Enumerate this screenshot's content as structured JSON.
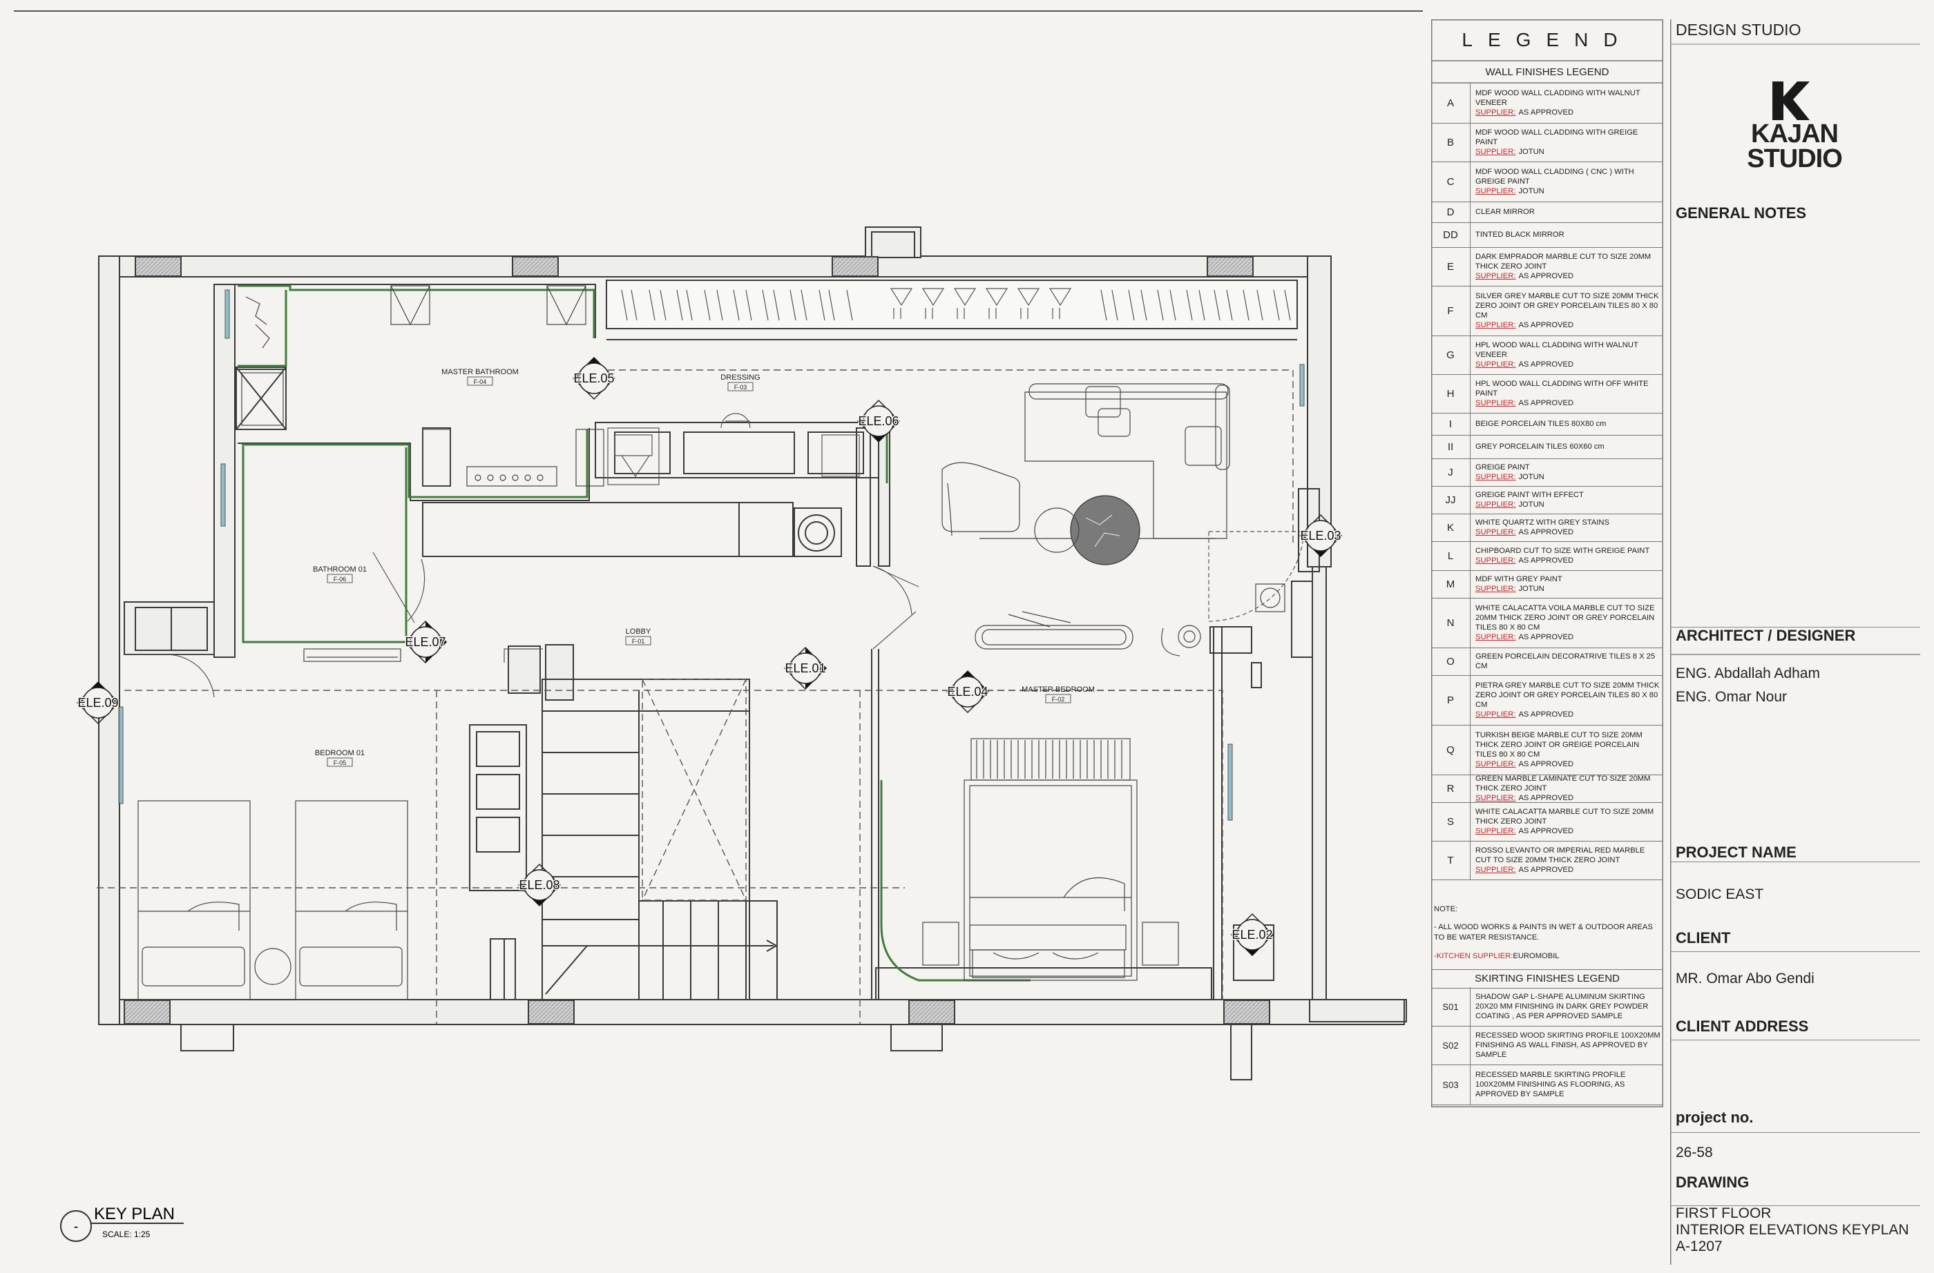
{
  "plan": {
    "rooms": [
      {
        "name": "MASTER BATHROOM",
        "code": "F-04"
      },
      {
        "name": "DRESSING",
        "code": "F-03"
      },
      {
        "name": "BATHROOM 01",
        "code": "F-06"
      },
      {
        "name": "LOBBY",
        "code": "F-01"
      },
      {
        "name": "BEDROOM 01",
        "code": "F-05"
      },
      {
        "name": "MASTER BEDROOM",
        "code": "F-02"
      }
    ],
    "elevation_tags": [
      "ELE.01",
      "ELE.02",
      "ELE.03",
      "ELE.04",
      "ELE.05",
      "ELE.06",
      "ELE.07",
      "ELE.08",
      "ELE.09"
    ],
    "key_plan": {
      "symbol": "-",
      "title": "KEY PLAN",
      "scale": "SCALE: 1:25"
    }
  },
  "legend": {
    "title": "LEGEND",
    "wall_title": "WALL FINISHES LEGEND",
    "supplier_label": "SUPPLIER:",
    "wall_items": [
      {
        "code": "A",
        "text": "MDF WOOD WALL CLADDING WITH WALNUT VENEER",
        "supplier": "AS APPROVED"
      },
      {
        "code": "B",
        "text": "MDF WOOD WALL CLADDING WITH  GREIGE PAINT",
        "supplier": "JOTUN"
      },
      {
        "code": "C",
        "text": "MDF WOOD WALL CLADDING ( CNC ) WITH GREIGE PAINT",
        "supplier": "JOTUN"
      },
      {
        "code": "D",
        "text": "CLEAR MIRROR",
        "supplier": ""
      },
      {
        "code": "DD",
        "text": "TINTED BLACK MIRROR",
        "supplier": ""
      },
      {
        "code": "E",
        "text": "DARK EMPRADOR MARBLE CUT TO SIZE 20MM THICK ZERO JOINT",
        "supplier": "AS APPROVED"
      },
      {
        "code": "F",
        "text": "SILVER GREY MARBLE CUT TO SIZE 20MM THICK ZERO JOINT OR GREY PORCELAIN TILES 80 X 80 CM",
        "supplier": "AS APPROVED"
      },
      {
        "code": "G",
        "text": "HPL WOOD WALL CLADDING WITH WALNUT VENEER",
        "supplier": "AS APPROVED"
      },
      {
        "code": "H",
        "text": "HPL WOOD WALL CLADDING WITH OFF WHITE PAINT",
        "supplier": "AS APPROVED"
      },
      {
        "code": "I",
        "text": "BEIGE PORCELAIN TILES  80X80 cm",
        "supplier": ""
      },
      {
        "code": "II",
        "text": "GREY PORCELAIN TILES  60X60 cm",
        "supplier": ""
      },
      {
        "code": "J",
        "text": "GREIGE PAINT",
        "supplier": "JOTUN"
      },
      {
        "code": "JJ",
        "text": "GREIGE PAINT WITH EFFECT",
        "supplier": "JOTUN"
      },
      {
        "code": "K",
        "text": "WHITE QUARTZ WITH GREY STAINS",
        "supplier": "AS APPROVED"
      },
      {
        "code": "L",
        "text": "CHIPBOARD  CUT TO SIZE WITH GREIGE PAINT",
        "supplier": "AS APPROVED"
      },
      {
        "code": "M",
        "text": "MDF WITH GREY PAINT",
        "supplier": "JOTUN"
      },
      {
        "code": "N",
        "text": "WHITE CALACATTA VOILA MARBLE CUT TO SIZE 20MM THICK ZERO JOINT OR GREY PORCELAIN TILES 80 X 80 CM",
        "supplier": "AS APPROVED"
      },
      {
        "code": "O",
        "text": "GREEN PORCELAIN DECORATRIVE TILES 8 X 25 CM",
        "supplier": ""
      },
      {
        "code": "P",
        "text": "PIETRA GREY  MARBLE CUT TO SIZE 20MM THICK ZERO JOINT OR GREY PORCELAIN TILES 80 X 80 CM",
        "supplier": "AS APPROVED"
      },
      {
        "code": "Q",
        "text": "TURKISH BEIGE MARBLE CUT TO SIZE 20MM THICK ZERO JOINT OR GREIGE PORCELAIN TILES 80 X 80 CM",
        "supplier": "AS APPROVED"
      },
      {
        "code": "R",
        "text": "GREEN MARBLE LAMINATE CUT TO SIZE 20MM THICK ZERO JOINT",
        "supplier": "AS APPROVED"
      },
      {
        "code": "S",
        "text": "WHITE CALACATTA MARBLE CUT TO SIZE 20MM THICK ZERO JOINT",
        "supplier": "AS APPROVED"
      },
      {
        "code": "T",
        "text": "ROSSO LEVANTO OR IMPERIAL RED MARBLE CUT TO SIZE 20MM THICK ZERO JOINT",
        "supplier": "AS APPROVED"
      }
    ],
    "note_label": "NOTE:",
    "note_text": "- ALL WOOD WORKS & PAINTS IN WET & OUTDOOR AREAS TO BE WATER RESISTANCE.",
    "kitchen_supplier": "-KITCHEN SUPPLIER:",
    "kitchen_supplier_value": "EUROMOBIL",
    "skirting_title": "SKIRTING FINISHES LEGEND",
    "skirting_items": [
      {
        "code": "S01",
        "text": "SHADOW GAP L-SHAPE ALUMINUM SKIRTING 20X20 MM FINISHING IN DARK GREY POWDER COATING , AS PER APPROVED SAMPLE"
      },
      {
        "code": "S02",
        "text": "RECESSED WOOD SKIRTING PROFILE 100X20MM FINISHING AS WALL FINISH, AS APPROVED BY SAMPLE"
      },
      {
        "code": "S03",
        "text": "RECESSED MARBLE SKIRTING PROFILE 100X20MM FINISHING AS FLOORING, AS APPROVED BY SAMPLE"
      }
    ]
  },
  "title_block": {
    "studio_label": "DESIGN STUDIO",
    "logo_line1": "KAJAN",
    "logo_line2": "STUDIO",
    "general_notes": "GENERAL NOTES",
    "architect_label": "ARCHITECT / DESIGNER",
    "architects": [
      "ENG. Abdallah Adham",
      "ENG. Omar Nour"
    ],
    "project_label": "PROJECT NAME",
    "project": "SODIC EAST",
    "client_label": "CLIENT",
    "client": "MR. Omar Abo Gendi",
    "client_address_label": "CLIENT ADDRESS",
    "project_no_label": "project no.",
    "project_no": "26-58",
    "drawing_label": "DRAWING",
    "drawing_lines": [
      "FIRST FLOOR",
      "INTERIOR ELEVATIONS KEYPLAN",
      "A-1207"
    ]
  },
  "colors": {
    "background": "#f4f3ef",
    "line": "#3a3a3a",
    "green": "#3f7d3a",
    "red": "#c0272d",
    "glass": "#7fb6c4"
  }
}
